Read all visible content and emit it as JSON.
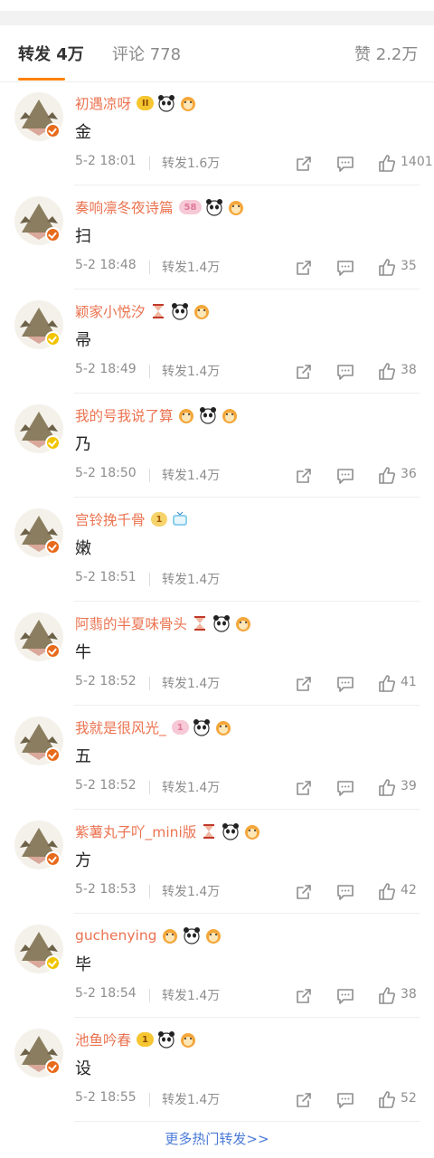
{
  "tabs": [
    {
      "label": "转发 4万",
      "active": true
    },
    {
      "label": "评论 778",
      "active": false
    },
    {
      "label": "赞 2.2万",
      "active": false
    }
  ],
  "comments": [
    {
      "user": "初遇凉呀",
      "badge": "II",
      "badge_style": "crown",
      "content": "金",
      "time": "5-2 18:01",
      "repost": "转发1.6万",
      "likes": "1401",
      "verify": "red"
    },
    {
      "user": "奏响凛冬夜诗篇",
      "badge": "58",
      "badge_style": "pink",
      "content": "扫",
      "time": "5-2 18:48",
      "repost": "转发1.4万",
      "likes": "35",
      "verify": "red"
    },
    {
      "user": "颖家小悦汐",
      "badge": "",
      "badge_style": "",
      "content": "帚",
      "time": "5-2 18:49",
      "repost": "转发1.4万",
      "likes": "38",
      "verify": "yellow"
    },
    {
      "user": "我的号我说了算",
      "badge": "",
      "badge_style": "",
      "content": "乃",
      "time": "5-2 18:50",
      "repost": "转发1.4万",
      "likes": "36",
      "verify": "yellow"
    },
    {
      "user": "宫铃挽千骨",
      "badge": "1",
      "badge_style": "orange",
      "content": "嫩",
      "time": "5-2 18:51",
      "repost": "转发1.4万",
      "likes": "",
      "verify": "red"
    },
    {
      "user": "阿翡的半夏味骨头",
      "badge": "",
      "badge_style": "",
      "content": "牛",
      "time": "5-2 18:52",
      "repost": "转发1.4万",
      "likes": "41",
      "verify": "red"
    },
    {
      "user": "我就是很风光_",
      "badge": "1",
      "badge_style": "pink",
      "content": "五",
      "time": "5-2 18:52",
      "repost": "转发1.4万",
      "likes": "39",
      "verify": "red"
    },
    {
      "user": "紫薯丸子吖_mini版",
      "badge": "",
      "badge_style": "",
      "content": "方",
      "time": "5-2 18:53",
      "repost": "转发1.4万",
      "likes": "42",
      "verify": "red"
    },
    {
      "user": "guchenying",
      "badge": "",
      "badge_style": "",
      "content": "毕",
      "time": "5-2 18:54",
      "repost": "转发1.4万",
      "likes": "38",
      "verify": "yellow"
    },
    {
      "user": "池鱼吟春",
      "badge": "1",
      "badge_style": "crown",
      "content": "设",
      "time": "5-2 18:55",
      "repost": "转发1.4万",
      "likes": "52",
      "verify": "red"
    }
  ],
  "more_link": "更多热门转发>>",
  "colors": {
    "accent": "#ff8200",
    "username": "#eb7350",
    "link": "#4b7bd8"
  }
}
